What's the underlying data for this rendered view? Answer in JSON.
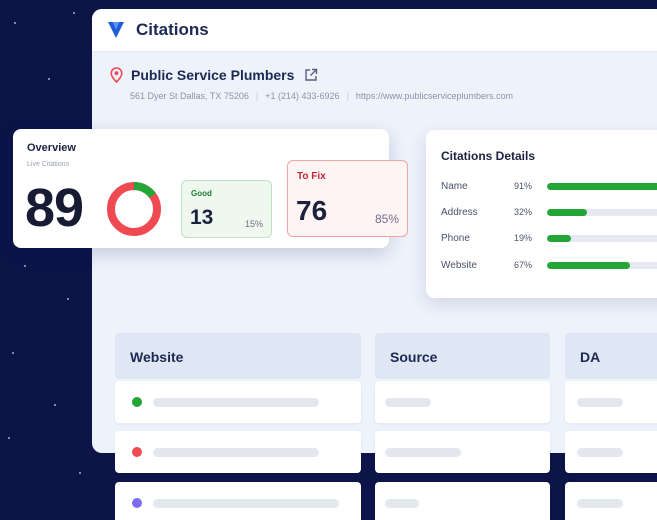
{
  "app": {
    "title": "Citations"
  },
  "business": {
    "name": "Public Service Plumbers",
    "address": "561 Dyer St Dallas, TX 75206",
    "phone": "+1 (214) 433-6926",
    "website": "https://www.publicserviceplumbers.com"
  },
  "overview": {
    "title": "Overview",
    "subtitle": "Live Citations",
    "total": "89",
    "good": {
      "label": "Good",
      "value": "13",
      "percent": "15%"
    },
    "to_fix": {
      "label": "To Fix",
      "value": "76",
      "percent": "85%"
    },
    "donut": {
      "good_fraction": 0.15,
      "good_color": "#24a637",
      "fix_color": "#ef4a52"
    }
  },
  "details": {
    "title": "Citations Details",
    "rows": [
      {
        "label": "Name",
        "percent": "91%",
        "fill": 0.91
      },
      {
        "label": "Address",
        "percent": "32%",
        "fill": 0.32
      },
      {
        "label": "Phone",
        "percent": "19%",
        "fill": 0.19
      },
      {
        "label": "Website",
        "percent": "67%",
        "fill": 0.67
      }
    ],
    "bar_color": "#24a637"
  },
  "table": {
    "columns": [
      "Website",
      "Source",
      "DA"
    ],
    "row_dot_colors": [
      "#24a637",
      "#ef4a52",
      "#7b6cf0"
    ]
  },
  "colors": {
    "background": "#0c1448",
    "accent": "#1f5fd6",
    "good": "#24a637",
    "fix": "#ef4a52"
  }
}
